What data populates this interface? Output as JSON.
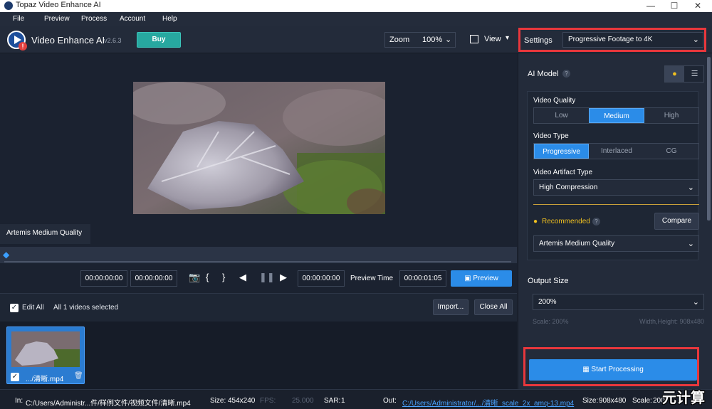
{
  "window": {
    "title": "Topaz Video Enhance AI",
    "minimize": "—",
    "maximize": "☐",
    "close": "✕"
  },
  "menu": [
    "File",
    "Preview",
    "Process",
    "Account",
    "Help"
  ],
  "toolbar": {
    "app_name": "Video Enhance AI",
    "version": "v2.6.3",
    "buy_label": "Buy",
    "zoom_label": "Zoom",
    "zoom_value": "100%",
    "view_label": "View",
    "settings_label": "Settings",
    "settings_value": "Progressive Footage to 4K"
  },
  "preview": {
    "model_tab": "Artemis Medium Quality"
  },
  "transport": {
    "in_time": "00:00:00:00",
    "out_time": "00:00:00:00",
    "current_time": "00:00:00:00",
    "preview_time_label": "Preview Time",
    "preview_time_value": "00:00:01:05",
    "preview_button": "Preview",
    "icons": [
      "camera-icon",
      "bracket-open-icon",
      "bracket-close-icon",
      "step-back-icon",
      "pause-icon",
      "step-forward-icon"
    ]
  },
  "list": {
    "edit_all": "Edit All",
    "selected_text": "All 1 videos selected",
    "import_label": "Import...",
    "close_all_label": "Close All",
    "items": [
      {
        "name": ".../清晰.mp4",
        "checked": true
      }
    ]
  },
  "status": {
    "in_label": "In:",
    "in_path": "C:/Users/Administr...件/样例文件/视频文件/清晰.mp4",
    "size_label": "Size:",
    "size_value": "454x240",
    "fps_label": "FPS:",
    "fps_value": "25.000",
    "sar_label": "SAR:",
    "sar_value": "1",
    "out_label": "Out:",
    "out_path": "C:/Users/Administrator/.../清晰_scale_2x_amq-13.mp4",
    "out_size_label": "Size:",
    "out_size_value": "908x480",
    "scale_label": "Scale:",
    "scale_value": "200"
  },
  "panel": {
    "ai_model_title": "AI Model",
    "video_quality_label": "Video Quality",
    "video_quality_options": [
      "Low",
      "Medium",
      "High"
    ],
    "video_quality_selected": "Medium",
    "video_type_label": "Video Type",
    "video_type_options": [
      "Progressive",
      "Interlaced",
      "CG"
    ],
    "video_type_selected": "Progressive",
    "artifact_label": "Video Artifact Type",
    "artifact_value": "High Compression",
    "recommended_label": "Recommended",
    "compare_label": "Compare",
    "model_value": "Artemis Medium Quality",
    "output_size_title": "Output Size",
    "output_size_value": "200%",
    "scale_text": "Scale: 200%",
    "wh_text": "Width,Height: 908x480",
    "start_label": "Start Processing"
  },
  "watermark": "元计算",
  "colors": {
    "accent": "#2b8ce8",
    "highlight_frame": "#e8373c",
    "teal_buy": "#27a8a0"
  }
}
